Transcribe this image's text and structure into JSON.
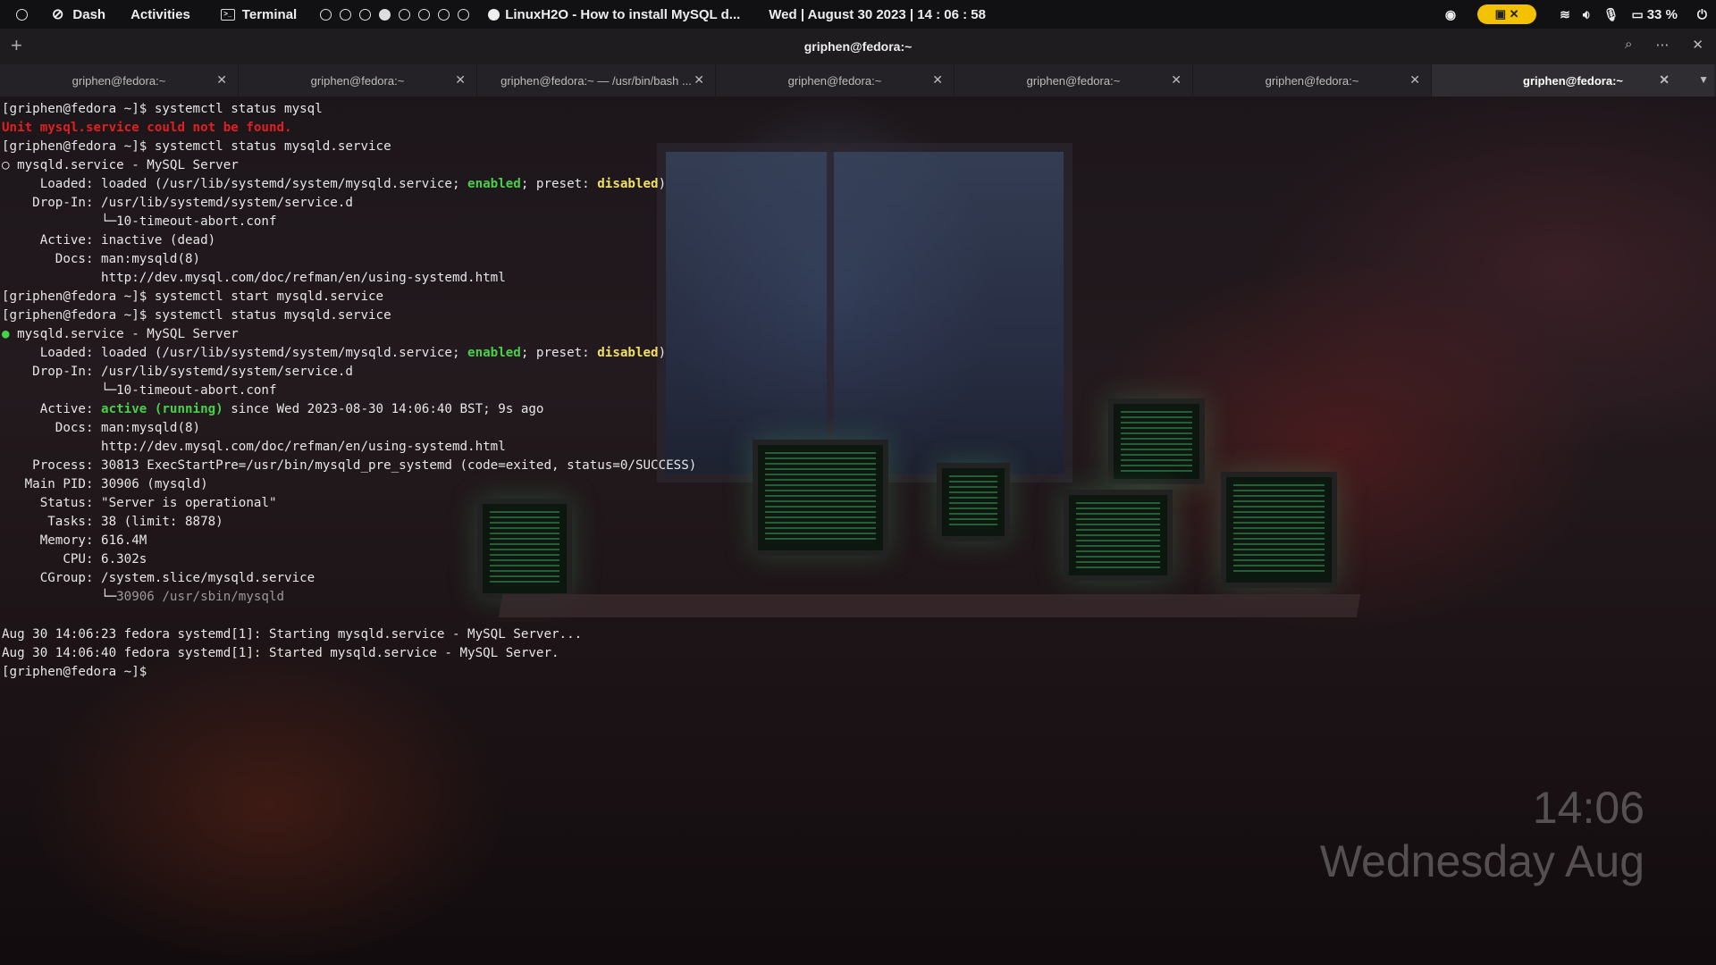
{
  "top_panel": {
    "dash": "Dash",
    "activities": "Activities",
    "terminal": "Terminal",
    "window_title": "LinuxH2O - How to install MySQL d...",
    "datetime": "Wed | August 30 2023 | 14 : 06 : 58",
    "battery": "33 %"
  },
  "terminal_window": {
    "title": "griphen@fedora:~"
  },
  "tabs": [
    {
      "label": "griphen@fedora:~"
    },
    {
      "label": "griphen@fedora:~"
    },
    {
      "label": "griphen@fedora:~ — /usr/bin/bash ..."
    },
    {
      "label": "griphen@fedora:~"
    },
    {
      "label": "griphen@fedora:~"
    },
    {
      "label": "griphen@fedora:~"
    },
    {
      "label": "griphen@fedora:~"
    }
  ],
  "terminal": {
    "l1": "[griphen@fedora ~]$ systemctl status mysql",
    "l2": "Unit mysql.service could not be found.",
    "l3": "[griphen@fedora ~]$ systemctl status mysqld.service",
    "l4": "○ mysqld.service - MySQL Server",
    "l5a": "     Loaded: loaded (/usr/lib/systemd/system/mysqld.service; ",
    "l5b": "enabled",
    "l5c": "; preset: ",
    "l5d": "disabled",
    "l5e": ")",
    "l6": "    Drop-In: /usr/lib/systemd/system/service.d",
    "l7": "             └─10-timeout-abort.conf",
    "l8": "     Active: inactive (dead)",
    "l9": "       Docs: man:mysqld(8)",
    "l10": "             http://dev.mysql.com/doc/refman/en/using-systemd.html",
    "l11": "[griphen@fedora ~]$ systemctl start mysqld.service",
    "l12": "[griphen@fedora ~]$ systemctl status mysqld.service",
    "l13a": "● ",
    "l13b": "mysqld.service - MySQL Server",
    "l14a": "     Loaded: loaded (/usr/lib/systemd/system/mysqld.service; ",
    "l14b": "enabled",
    "l14c": "; preset: ",
    "l14d": "disabled",
    "l14e": ")",
    "l15": "    Drop-In: /usr/lib/systemd/system/service.d",
    "l16": "             └─10-timeout-abort.conf",
    "l17a": "     Active: ",
    "l17b": "active (running)",
    "l17c": " since Wed 2023-08-30 14:06:40 BST; 9s ago",
    "l18": "       Docs: man:mysqld(8)",
    "l19": "             http://dev.mysql.com/doc/refman/en/using-systemd.html",
    "l20": "    Process: 30813 ExecStartPre=/usr/bin/mysqld_pre_systemd (code=exited, status=0/SUCCESS)",
    "l21": "   Main PID: 30906 (mysqld)",
    "l22": "     Status: \"Server is operational\"",
    "l23": "      Tasks: 38 (limit: 8878)",
    "l24": "     Memory: 616.4M",
    "l25": "        CPU: 6.302s",
    "l26": "     CGroup: /system.slice/mysqld.service",
    "l27a": "             └─",
    "l27b": "30906 /usr/sbin/mysqld",
    "l29": "Aug 30 14:06:23 fedora systemd[1]: Starting mysqld.service - MySQL Server...",
    "l30": "Aug 30 14:06:40 fedora systemd[1]: Started mysqld.service - MySQL Server.",
    "l31": "[griphen@fedora ~]$ "
  },
  "clock_overlay": {
    "time": "14:06",
    "date": "Wednesday Aug"
  }
}
